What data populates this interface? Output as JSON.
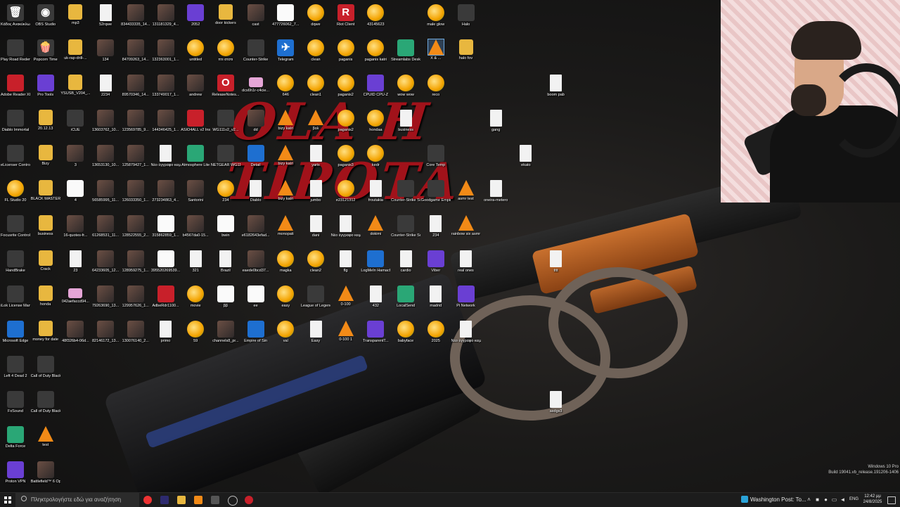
{
  "wallpaper": {
    "title": "OLA H TIPOTA"
  },
  "desktop_icons": [
    {
      "label": "Κάδος Ανακύκλωσης",
      "type": "app",
      "glyph": "🗑"
    },
    {
      "label": "OBS Studio",
      "type": "app",
      "glyph": "◉"
    },
    {
      "label": "mp3",
      "type": "folder"
    },
    {
      "label": "52rqwe",
      "type": "file"
    },
    {
      "label": "834433335_14...",
      "type": "img"
    },
    {
      "label": "131181329_4...",
      "type": "img"
    },
    {
      "label": "2052",
      "type": "purple"
    },
    {
      "label": "door kickers",
      "type": "folder"
    },
    {
      "label": "cast",
      "type": "img"
    },
    {
      "label": "477726062_7...",
      "type": "white"
    },
    {
      "label": "dqwe",
      "type": "fl"
    },
    {
      "label": "Riot Client",
      "type": "red",
      "glyph": "R"
    },
    {
      "label": "43145623",
      "type": "fl"
    },
    {
      "label": "male glow",
      "type": "fl"
    },
    {
      "label": "Halo",
      "type": "app"
    },
    {
      "label": "Play Road Redemption",
      "type": "app"
    },
    {
      "label": "Popcorn Time",
      "type": "app",
      "glyph": "🍿"
    },
    {
      "label": "uk-rap-drill-...",
      "type": "folder"
    },
    {
      "label": "134",
      "type": "img"
    },
    {
      "label": "84709263_14...",
      "type": "img"
    },
    {
      "label": "132363001_1...",
      "type": "img"
    },
    {
      "label": "untitled",
      "type": "fl"
    },
    {
      "label": "πτι στστι",
      "type": "fl"
    },
    {
      "label": "Counter-Strike",
      "type": "app"
    },
    {
      "label": "Telegram",
      "type": "blue",
      "glyph": "✈"
    },
    {
      "label": "clean",
      "type": "fl"
    },
    {
      "label": "paganis",
      "type": "fl"
    },
    {
      "label": "paganis katri",
      "type": "fl"
    },
    {
      "label": "Streamlabs Desktop",
      "type": "green"
    },
    {
      "label": "X & ...",
      "type": "vlc"
    },
    {
      "label": "halo fov",
      "type": "folder"
    },
    {
      "label": "Adobe Reader XI",
      "type": "red"
    },
    {
      "label": "Pro Tools",
      "type": "purple"
    },
    {
      "label": "YSUSB_V204_...",
      "type": "folder"
    },
    {
      "label": "2234",
      "type": "file"
    },
    {
      "label": "89570346_14...",
      "type": "img"
    },
    {
      "label": "133749017_1...",
      "type": "img"
    },
    {
      "label": "andrew",
      "type": "img"
    },
    {
      "label": "ReleaseNotes...",
      "type": "red",
      "glyph": "O"
    },
    {
      "label": "dcs6h1r-c4cie...",
      "type": "pink"
    },
    {
      "label": "646",
      "type": "fl"
    },
    {
      "label": "clean1",
      "type": "fl"
    },
    {
      "label": "paganis2",
      "type": "fl"
    },
    {
      "label": "CPUID CPU-Z",
      "type": "purple"
    },
    {
      "label": "wow wow",
      "type": "fl"
    },
    {
      "label": "reco",
      "type": "fl"
    },
    {
      "label": "boom pab",
      "type": "file"
    },
    {
      "label": "Diablo Immortal",
      "type": "app"
    },
    {
      "label": "20.12.13",
      "type": "folder"
    },
    {
      "label": "iCUE",
      "type": "app"
    },
    {
      "label": "13603762_10...",
      "type": "img"
    },
    {
      "label": "123569785_9...",
      "type": "img"
    },
    {
      "label": "144346425_1...",
      "type": "img"
    },
    {
      "label": "ASIO4ALL v2 Instruction...",
      "type": "red"
    },
    {
      "label": "WG111v2_v2...",
      "type": "app"
    },
    {
      "label": "dd",
      "type": "img"
    },
    {
      "label": "bizy katri",
      "type": "vlc"
    },
    {
      "label": "βολ",
      "type": "vlc"
    },
    {
      "label": "paganis2",
      "type": "fl"
    },
    {
      "label": "hondaa",
      "type": "fl"
    },
    {
      "label": "business",
      "type": "file"
    },
    {
      "label": "gang",
      "type": "file"
    },
    {
      "label": "eLicenser Control Center",
      "type": "app"
    },
    {
      "label": "Bizy",
      "type": "folder"
    },
    {
      "label": "3",
      "type": "img"
    },
    {
      "label": "13653130_10...",
      "type": "img"
    },
    {
      "label": "125879427_1...",
      "type": "img"
    },
    {
      "label": "Νέο έγγραφο κειμένου (5)",
      "type": "file"
    },
    {
      "label": "Atmosphere Lite",
      "type": "green"
    },
    {
      "label": "NETGEAR WG111v3 S...",
      "type": "app"
    },
    {
      "label": "Detail",
      "type": "blue"
    },
    {
      "label": "bizy katri",
      "type": "vlc"
    },
    {
      "label": "yaris",
      "type": "file"
    },
    {
      "label": "paganis3",
      "type": "fl"
    },
    {
      "label": "kedr",
      "type": "fl"
    },
    {
      "label": "Core Temp",
      "type": "app"
    },
    {
      "label": "ekato",
      "type": "file"
    },
    {
      "label": "FL Studio 20",
      "type": "fl"
    },
    {
      "label": "BLACK MASTERS",
      "type": "folder"
    },
    {
      "label": "4",
      "type": "white"
    },
    {
      "label": "56585995_11...",
      "type": "img"
    },
    {
      "label": "126033350_1...",
      "type": "img"
    },
    {
      "label": "273234863_4...",
      "type": "img"
    },
    {
      "label": "Santorini",
      "type": "img"
    },
    {
      "label": "234",
      "type": "fl"
    },
    {
      "label": "Diablo",
      "type": "file"
    },
    {
      "label": "bizy katri",
      "type": "vlc"
    },
    {
      "label": "jumbo",
      "type": "file"
    },
    {
      "label": "e23121312",
      "type": "fl"
    },
    {
      "label": "froutakia",
      "type": "file"
    },
    {
      "label": "Counter-Strike Source",
      "type": "app"
    },
    {
      "label": "Goodgame Empire",
      "type": "app"
    },
    {
      "label": "asmr test",
      "type": "vlc"
    },
    {
      "label": "oneira-metero",
      "type": "file"
    },
    {
      "label": "Focusrite Control",
      "type": "app"
    },
    {
      "label": "business",
      "type": "folder"
    },
    {
      "label": "16-quotes-fr...",
      "type": "img"
    },
    {
      "label": "61268531_11...",
      "type": "img"
    },
    {
      "label": "128522555_2...",
      "type": "img"
    },
    {
      "label": "315862859_1...",
      "type": "white"
    },
    {
      "label": "b4567da0-15...",
      "type": "img"
    },
    {
      "label": "bwin",
      "type": "white"
    },
    {
      "label": "e6182643efad...",
      "type": "img"
    },
    {
      "label": "monopati",
      "type": "vlc"
    },
    {
      "label": "dani",
      "type": "file"
    },
    {
      "label": "Νέο έγγραφο κειμένου",
      "type": "file"
    },
    {
      "label": "dokimi",
      "type": "vlc"
    },
    {
      "label": "Counter-Strike Source [TL]",
      "type": "app"
    },
    {
      "label": "234",
      "type": "file"
    },
    {
      "label": "rainbow six asmr",
      "type": "vlc"
    },
    {
      "label": "HandBrake",
      "type": "app"
    },
    {
      "label": "Crack",
      "type": "folder"
    },
    {
      "label": "23",
      "type": "file"
    },
    {
      "label": "64233605_12...",
      "type": "img"
    },
    {
      "label": "128959275_1...",
      "type": "img"
    },
    {
      "label": "395520269539...",
      "type": "white"
    },
    {
      "label": "321",
      "type": "file"
    },
    {
      "label": "Brazil",
      "type": "file"
    },
    {
      "label": "eaede0bcd37...",
      "type": "img"
    },
    {
      "label": "magka",
      "type": "fl"
    },
    {
      "label": "clean2",
      "type": "fl"
    },
    {
      "label": "flg",
      "type": "file"
    },
    {
      "label": "LogMeIn Hamachi",
      "type": "blue"
    },
    {
      "label": "cardio",
      "type": "file"
    },
    {
      "label": "Viber",
      "type": "purple"
    },
    {
      "label": "real ones",
      "type": "file"
    },
    {
      "label": "tttt",
      "type": "file"
    },
    {
      "label": "iLok License Manager",
      "type": "app"
    },
    {
      "label": "honda",
      "type": "folder"
    },
    {
      "label": "042aefaccd94...",
      "type": "pink"
    },
    {
      "label": "79263690_13...",
      "type": "img"
    },
    {
      "label": "129957626_1...",
      "type": "img"
    },
    {
      "label": "AdbeRdr1100...",
      "type": "red"
    },
    {
      "label": "movie",
      "type": "fl"
    },
    {
      "label": "ββ",
      "type": "white"
    },
    {
      "label": "ee",
      "type": "white"
    },
    {
      "label": "easy",
      "type": "fl"
    },
    {
      "label": "League of Legends",
      "type": "app"
    },
    {
      "label": "0-100",
      "type": "vlc"
    },
    {
      "label": "432",
      "type": "file"
    },
    {
      "label": "LocalSend",
      "type": "green"
    },
    {
      "label": "madrid",
      "type": "file"
    },
    {
      "label": "Pi Network",
      "type": "purple"
    },
    {
      "label": "Microsoft Edge",
      "type": "blue"
    },
    {
      "label": "money for date",
      "type": "folder"
    },
    {
      "label": "48f326b4-06d...",
      "type": "img"
    },
    {
      "label": "82146172_13...",
      "type": "img"
    },
    {
      "label": "130076140_2...",
      "type": "img"
    },
    {
      "label": "primo",
      "type": "file"
    },
    {
      "label": "59",
      "type": "fl"
    },
    {
      "label": "channels8_pr...",
      "type": "img"
    },
    {
      "label": "Empire of Sin",
      "type": "blue"
    },
    {
      "label": "val",
      "type": "fl"
    },
    {
      "label": "Easy",
      "type": "file"
    },
    {
      "label": "0-100 1",
      "type": "vlc"
    },
    {
      "label": "TransparentT...",
      "type": "purple"
    },
    {
      "label": "babyface",
      "type": "fl"
    },
    {
      "label": "2025",
      "type": "fl"
    },
    {
      "label": "Νέο έγγραφο κειμένου (4)",
      "type": "file"
    },
    {
      "label": "Left 4 Dead 2",
      "type": "app"
    },
    {
      "label": "Call of Duty Black Ops",
      "type": "app"
    },
    {
      "label": "FxSound",
      "type": "app"
    },
    {
      "label": "Call of Duty Black Ops...",
      "type": "app"
    },
    {
      "label": "Delta Force",
      "type": "green"
    },
    {
      "label": "test",
      "type": "vlc"
    },
    {
      "label": "Proton VPN",
      "type": "purple"
    },
    {
      "label": "Battlefield™ 6 Open Beta",
      "type": "img"
    },
    {
      "label": "asdgs3",
      "type": "file"
    }
  ],
  "watermark": {
    "line1": "Windows 10 Pro",
    "line2": "Build 19041.vb_release.191206-1406"
  },
  "taskbar": {
    "search_placeholder": "Πληκτρολογήστε εδώ για αναζήτηση",
    "news": "Washington Post: To...",
    "language": "ENG",
    "time": "12:42 μμ",
    "date": "24/8/2025"
  }
}
